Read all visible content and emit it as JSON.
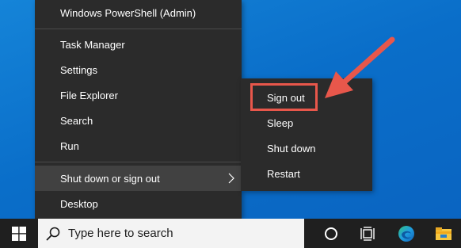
{
  "menu": {
    "items": [
      {
        "label": "Windows PowerShell (Admin)"
      },
      {
        "label": "Task Manager"
      },
      {
        "label": "Settings"
      },
      {
        "label": "File Explorer"
      },
      {
        "label": "Search"
      },
      {
        "label": "Run"
      },
      {
        "label": "Shut down or sign out",
        "has_submenu": true
      },
      {
        "label": "Desktop"
      }
    ]
  },
  "submenu": {
    "items": [
      {
        "label": "Sign out"
      },
      {
        "label": "Sleep"
      },
      {
        "label": "Shut down"
      },
      {
        "label": "Restart"
      }
    ]
  },
  "taskbar": {
    "search_placeholder": "Type here to search",
    "icons": [
      "windows-start-icon",
      "search-icon",
      "cortana-icon",
      "task-view-icon",
      "edge-icon",
      "file-explorer-icon"
    ]
  },
  "colors": {
    "desktop": "#0a6ec9",
    "menu_bg": "#2b2b2b",
    "highlight": "#e8574b",
    "taskbar": "#1f1f1f"
  }
}
